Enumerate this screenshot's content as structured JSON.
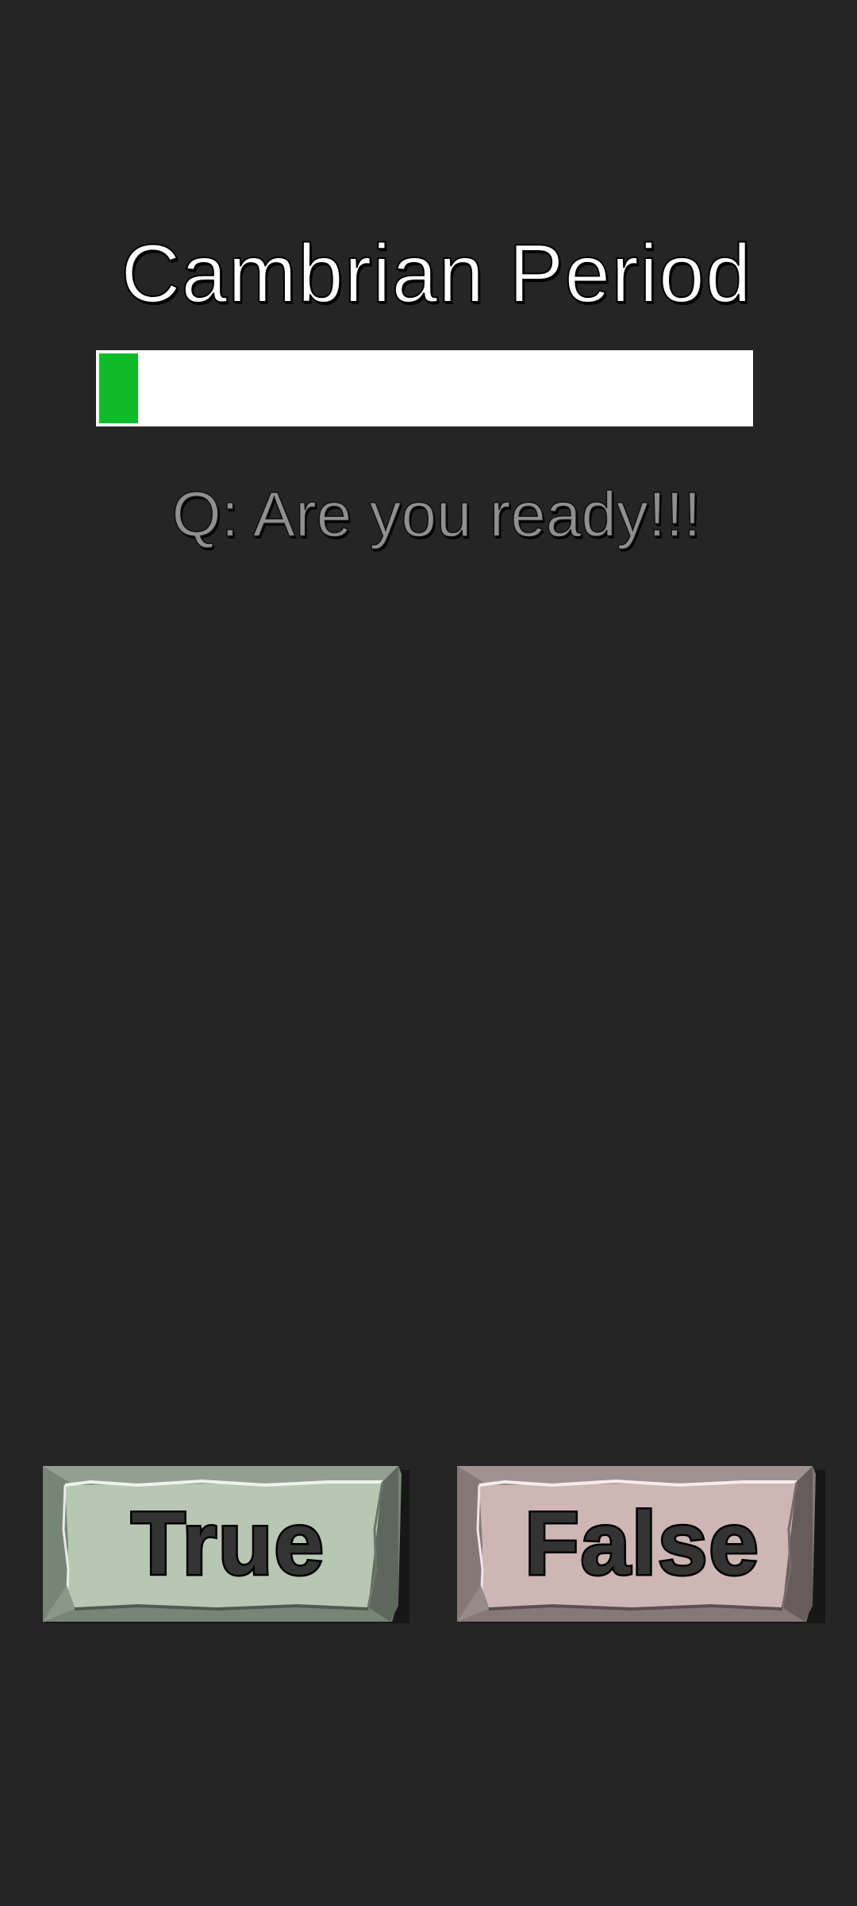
{
  "app": {
    "title": "Cambrian Period"
  },
  "progress": {
    "fraction": 0.06,
    "fill_color": "#10bb2a",
    "track_color": "#ffffff"
  },
  "question": {
    "text": "Q: Are you ready!!!"
  },
  "buttons": {
    "true_label": "True",
    "false_label": "False",
    "true_color": "#b8c6b4",
    "false_color": "#cdb6b4"
  }
}
